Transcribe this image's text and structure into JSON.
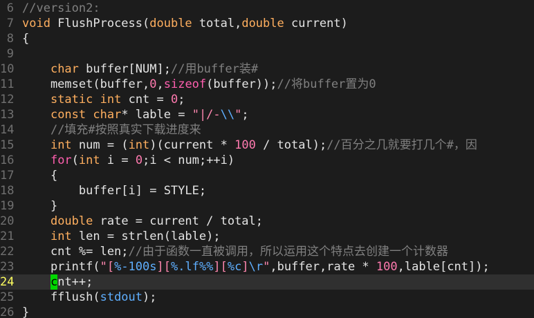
{
  "editor": {
    "current_line": 24,
    "lines": [
      {
        "n": "6",
        "tokens": [
          {
            "t": "//version2:",
            "k": "comment"
          }
        ]
      },
      {
        "n": "7",
        "tokens": [
          {
            "t": "void",
            "k": "type"
          },
          {
            "t": " FlushProcess(",
            "k": "text"
          },
          {
            "t": "double",
            "k": "type"
          },
          {
            "t": " total,",
            "k": "text"
          },
          {
            "t": "double",
            "k": "type"
          },
          {
            "t": " current)",
            "k": "text"
          }
        ]
      },
      {
        "n": "8",
        "tokens": [
          {
            "t": "{",
            "k": "text"
          }
        ]
      },
      {
        "n": "9",
        "tokens": []
      },
      {
        "n": "10",
        "tokens": [
          {
            "t": "    ",
            "k": "text"
          },
          {
            "t": "char",
            "k": "type"
          },
          {
            "t": " buffer[NUM];",
            "k": "text"
          },
          {
            "t": "//用buffer装#",
            "k": "comment"
          }
        ]
      },
      {
        "n": "11",
        "tokens": [
          {
            "t": "    memset(buffer,",
            "k": "text"
          },
          {
            "t": "0",
            "k": "num"
          },
          {
            "t": ",",
            "k": "text"
          },
          {
            "t": "sizeof",
            "k": "kw"
          },
          {
            "t": "(buffer));",
            "k": "text"
          },
          {
            "t": "//将buffer置为0",
            "k": "comment"
          }
        ]
      },
      {
        "n": "12",
        "tokens": [
          {
            "t": "    ",
            "k": "text"
          },
          {
            "t": "static",
            "k": "type"
          },
          {
            "t": " ",
            "k": "text"
          },
          {
            "t": "int",
            "k": "type"
          },
          {
            "t": " cnt = ",
            "k": "text"
          },
          {
            "t": "0",
            "k": "num"
          },
          {
            "t": ";",
            "k": "text"
          }
        ]
      },
      {
        "n": "13",
        "tokens": [
          {
            "t": "    ",
            "k": "text"
          },
          {
            "t": "const",
            "k": "type"
          },
          {
            "t": " ",
            "k": "text"
          },
          {
            "t": "char",
            "k": "type"
          },
          {
            "t": "* lable = ",
            "k": "text"
          },
          {
            "t": "\"|/-",
            "k": "str"
          },
          {
            "t": "\\\\",
            "k": "esc"
          },
          {
            "t": "\"",
            "k": "str"
          },
          {
            "t": ";",
            "k": "text"
          }
        ]
      },
      {
        "n": "14",
        "tokens": [
          {
            "t": "    ",
            "k": "text"
          },
          {
            "t": "//填充#按照真实下载进度来",
            "k": "comment"
          }
        ]
      },
      {
        "n": "15",
        "tokens": [
          {
            "t": "    ",
            "k": "text"
          },
          {
            "t": "int",
            "k": "type"
          },
          {
            "t": " num = (",
            "k": "text"
          },
          {
            "t": "int",
            "k": "type"
          },
          {
            "t": ")(current * ",
            "k": "text"
          },
          {
            "t": "100",
            "k": "num"
          },
          {
            "t": " / total);",
            "k": "text"
          },
          {
            "t": "//百分之几就要打几个#，因",
            "k": "comment"
          }
        ]
      },
      {
        "n": "16",
        "tokens": [
          {
            "t": "    ",
            "k": "text"
          },
          {
            "t": "for",
            "k": "kw"
          },
          {
            "t": "(",
            "k": "text"
          },
          {
            "t": "int",
            "k": "type"
          },
          {
            "t": " i = ",
            "k": "text"
          },
          {
            "t": "0",
            "k": "num"
          },
          {
            "t": ";i < num;++i)",
            "k": "text"
          }
        ]
      },
      {
        "n": "17",
        "tokens": [
          {
            "t": "    {",
            "k": "text"
          }
        ]
      },
      {
        "n": "18",
        "tokens": [
          {
            "t": "        buffer[i] = STYLE;",
            "k": "text"
          }
        ]
      },
      {
        "n": "19",
        "tokens": [
          {
            "t": "    }",
            "k": "text"
          }
        ]
      },
      {
        "n": "20",
        "tokens": [
          {
            "t": "    ",
            "k": "text"
          },
          {
            "t": "double",
            "k": "type"
          },
          {
            "t": " rate = current / total;",
            "k": "text"
          }
        ]
      },
      {
        "n": "21",
        "tokens": [
          {
            "t": "    ",
            "k": "text"
          },
          {
            "t": "int",
            "k": "type"
          },
          {
            "t": " len = strlen(lable);",
            "k": "text"
          }
        ]
      },
      {
        "n": "22",
        "tokens": [
          {
            "t": "    cnt %= len;",
            "k": "text"
          },
          {
            "t": "//由于函数一直被调用，所以运用这个特点去创建一个计数器",
            "k": "comment"
          }
        ]
      },
      {
        "n": "23",
        "tokens": [
          {
            "t": "    printf(",
            "k": "text"
          },
          {
            "t": "\"[",
            "k": "str"
          },
          {
            "t": "%-100s",
            "k": "esc"
          },
          {
            "t": "][",
            "k": "str"
          },
          {
            "t": "%.lf",
            "k": "esc"
          },
          {
            "t": "%%",
            "k": "esc"
          },
          {
            "t": "][",
            "k": "str"
          },
          {
            "t": "%c",
            "k": "esc"
          },
          {
            "t": "]",
            "k": "str"
          },
          {
            "t": "\\r",
            "k": "esc"
          },
          {
            "t": "\"",
            "k": "str"
          },
          {
            "t": ",buffer,rate * ",
            "k": "text"
          },
          {
            "t": "100",
            "k": "num"
          },
          {
            "t": ",lable[cnt]);",
            "k": "text"
          }
        ]
      },
      {
        "n": "24",
        "tokens": [
          {
            "t": "    ",
            "k": "text"
          },
          {
            "t": "c",
            "k": "cursor"
          },
          {
            "t": "nt++;",
            "k": "text"
          }
        ]
      },
      {
        "n": "25",
        "tokens": [
          {
            "t": "    fflush(",
            "k": "text"
          },
          {
            "t": "stdout",
            "k": "lib"
          },
          {
            "t": ");",
            "k": "text"
          }
        ]
      },
      {
        "n": "26",
        "tokens": [
          {
            "t": "}",
            "k": "text"
          }
        ]
      }
    ]
  },
  "colors": {
    "background": "#1c1c1c",
    "current_line_bg": "#303030",
    "line_number": "#707070",
    "current_line_number": "#ffff5f",
    "cursor": "#00d700",
    "comment": "#808080",
    "type": "#ffaf5f",
    "keyword": "#ff5faf",
    "string": "#ff87af",
    "escape": "#5fafff"
  }
}
